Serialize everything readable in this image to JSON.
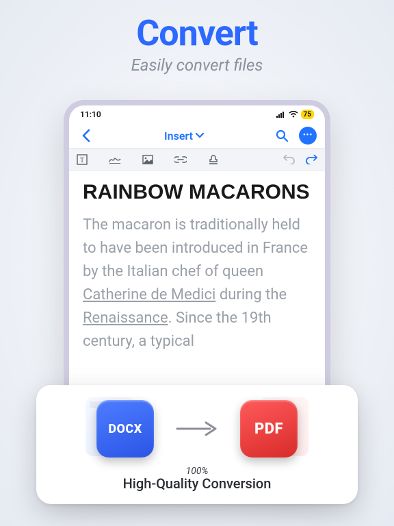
{
  "hero": {
    "title": "Convert",
    "subtitle": "Easily convert files"
  },
  "status": {
    "time": "11:10",
    "battery": "75"
  },
  "nav": {
    "center_label": "Insert"
  },
  "doc": {
    "title": "RAINBOW MACARONS",
    "p1a": "The macaron is traditionally held to have been introduced in France by the Italian chef of queen ",
    "p1_link1": "Catherine de Medici",
    "p1b": " during the ",
    "p1_link2": "Renaissance",
    "p1c": ". Since the 19th century, a typical"
  },
  "card": {
    "from_label": "DOCX",
    "to_label": "PDF",
    "percent": "100%",
    "caption": "High-Quality Conversion"
  }
}
